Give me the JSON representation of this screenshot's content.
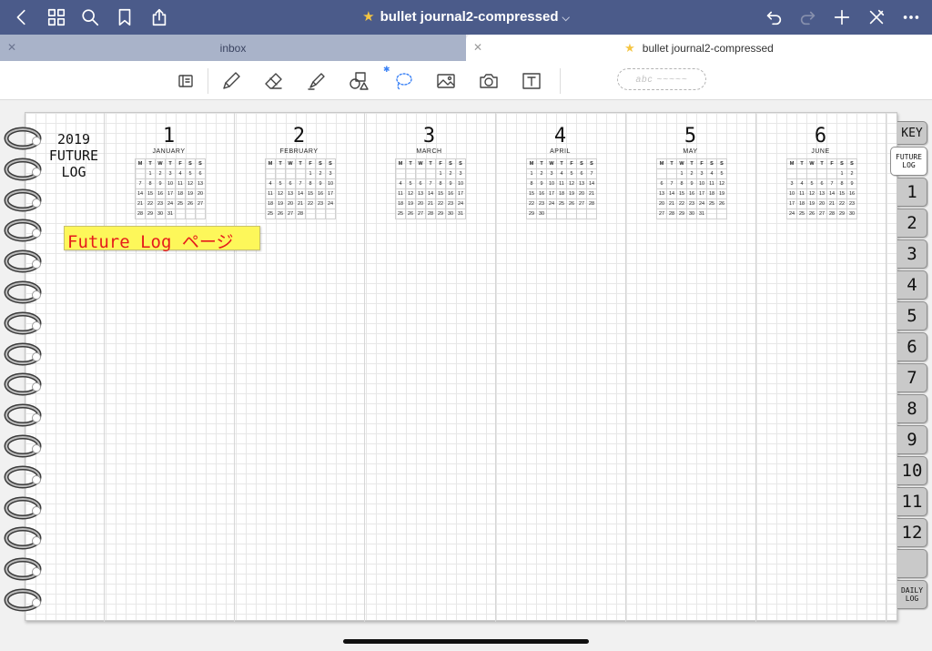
{
  "navbar": {
    "title": "bullet journal2-compressed",
    "icons": [
      "back-icon",
      "grid-icon",
      "search-icon",
      "bookmark-icon",
      "share-icon",
      "undo-icon",
      "redo-icon",
      "add-icon",
      "close-toolbar-icon",
      "more-icon"
    ]
  },
  "tabs": [
    {
      "label": "inbox",
      "active": false
    },
    {
      "label": "bullet journal2-compressed",
      "active": true
    }
  ],
  "toolbar": {
    "tools": [
      "reader-icon",
      "pen-icon",
      "eraser-icon",
      "highlighter-icon",
      "shapes-icon",
      "lasso-icon",
      "image-icon",
      "camera-icon",
      "text-icon"
    ],
    "handwriting_placeholder": "abc ~~~~~"
  },
  "page": {
    "future_log_title": [
      "2019",
      "FUTURE",
      "LOG"
    ],
    "sticky_note": "Future Log ページ",
    "weekday_headers": [
      "M",
      "T",
      "W",
      "T",
      "F",
      "S",
      "S"
    ],
    "months": [
      {
        "num": "1",
        "name": "JANUARY",
        "offset": 1,
        "days": 31
      },
      {
        "num": "2",
        "name": "FEBRUARY",
        "offset": 4,
        "days": 28
      },
      {
        "num": "3",
        "name": "MARCH",
        "offset": 4,
        "days": 31
      },
      {
        "num": "4",
        "name": "APRIL",
        "offset": 0,
        "days": 30
      },
      {
        "num": "5",
        "name": "MAY",
        "offset": 2,
        "days": 31
      },
      {
        "num": "6",
        "name": "JUNE",
        "offset": 5,
        "days": 30
      }
    ]
  },
  "side_tabs": [
    {
      "label": "KEY",
      "type": "key"
    },
    {
      "label": "FUTURE LOG",
      "type": "small",
      "active": true
    },
    {
      "label": "1"
    },
    {
      "label": "2"
    },
    {
      "label": "3"
    },
    {
      "label": "4"
    },
    {
      "label": "5"
    },
    {
      "label": "6"
    },
    {
      "label": "7"
    },
    {
      "label": "8"
    },
    {
      "label": "9"
    },
    {
      "label": "10"
    },
    {
      "label": "11"
    },
    {
      "label": "12"
    },
    {
      "label": ""
    },
    {
      "label": "DAILY LOG",
      "type": "small"
    }
  ],
  "colors": {
    "navbar": "#4b5b8a",
    "inbox_tab": "#a9b3c9",
    "sticky": "#fdf75a",
    "sticky_text": "#e51b1b",
    "star": "#f5c542"
  }
}
